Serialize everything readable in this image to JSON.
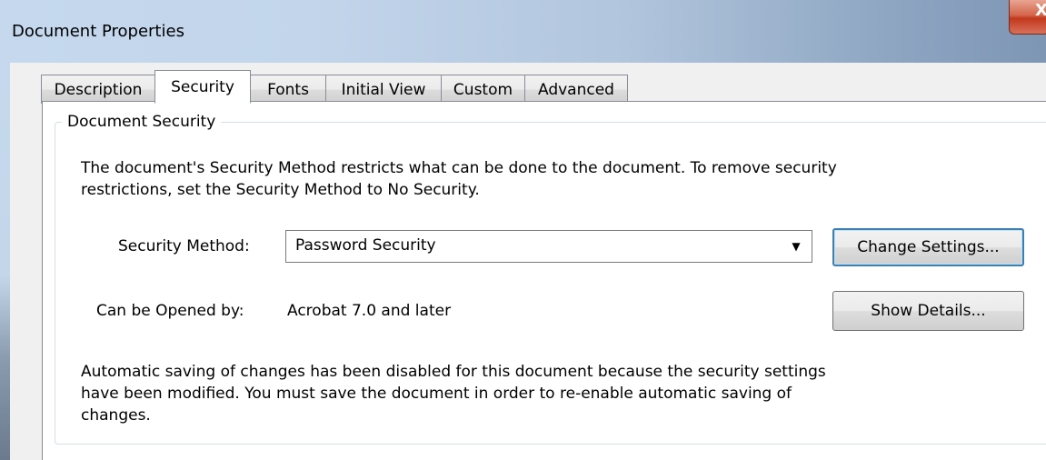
{
  "window": {
    "title": "Document Properties",
    "close_glyph": "X"
  },
  "tabs": [
    {
      "label": "Description",
      "active": false
    },
    {
      "label": "Security",
      "active": true
    },
    {
      "label": "Fonts",
      "active": false
    },
    {
      "label": "Initial View",
      "active": false
    },
    {
      "label": "Custom",
      "active": false
    },
    {
      "label": "Advanced",
      "active": false
    }
  ],
  "security": {
    "group_title": "Document Security",
    "intro_line1": "The document's Security Method restricts what can be done to the document. To remove security",
    "intro_line2": "restrictions, set the Security Method to No Security.",
    "method_label": "Security Method:",
    "method_value": "Password Security",
    "change_settings_label": "Change Settings...",
    "opened_by_label": "Can be Opened by:",
    "opened_by_value": "Acrobat 7.0 and later",
    "show_details_label": "Show Details...",
    "notice_line1": "Automatic saving of changes has been disabled for this document because the security settings",
    "notice_line2": "have been modified. You must save the document in order to re-enable automatic saving of",
    "notice_line3": "changes."
  },
  "icons": {
    "dropdown": "chevron-down-icon",
    "close": "close-icon"
  },
  "colors": {
    "close_button": "#c2391d",
    "focus_border": "#3c7fb1",
    "tab_border": "#898c95"
  }
}
